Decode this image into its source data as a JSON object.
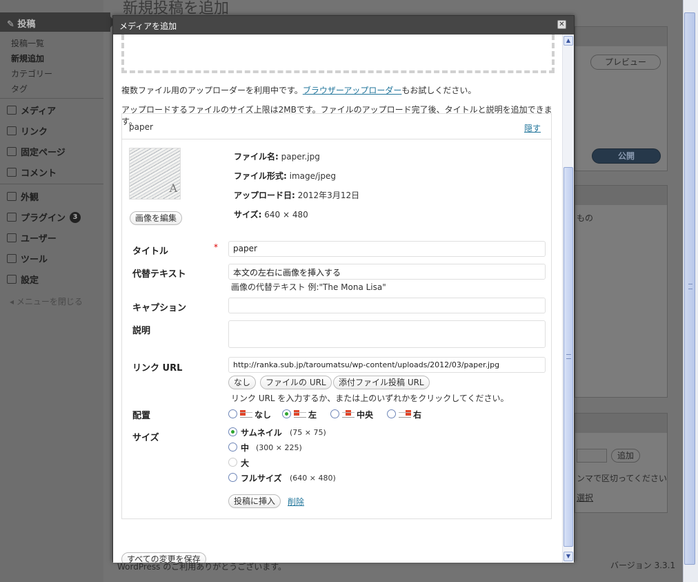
{
  "background": {
    "page_title": "新規投稿を追加",
    "menu_active": "投稿",
    "submenu": [
      "投稿一覧",
      "新規追加",
      "カテゴリー",
      "タグ"
    ],
    "menu": [
      {
        "label": "メディア",
        "icon": "media-icon"
      },
      {
        "label": "リンク",
        "icon": "link-icon"
      },
      {
        "label": "固定ページ",
        "icon": "page-icon"
      },
      {
        "label": "コメント",
        "icon": "comment-icon"
      },
      {
        "label": "外観",
        "icon": "appearance-icon"
      },
      {
        "label": "プラグイン",
        "icon": "plugin-icon",
        "badge": "3"
      },
      {
        "label": "ユーザー",
        "icon": "users-icon"
      },
      {
        "label": "ツール",
        "icon": "tools-icon"
      },
      {
        "label": "設定",
        "icon": "settings-icon"
      }
    ],
    "collapse_label": "メニューを閉じる",
    "preview_label": "プレビュー",
    "publish_label": "公開",
    "add_label": "追加",
    "side_text_1": "もの",
    "side_text_2": "ンマで区切ってください",
    "side_text_3": "選択",
    "footer_left": "WordPress のご利用ありがとうございます。",
    "version": "バージョン 3.3.1"
  },
  "modal": {
    "title": "メディアを追加",
    "close_glyph": "✕",
    "multi_uploader_note_pre": "複数ファイル用のアップローダーを利用中です。",
    "multi_uploader_link": "ブラウザーアップローダー",
    "multi_uploader_note_post": "もお試しください。",
    "size_limit_note": "アップロードするファイルのサイズ上限は2MBです。ファイルのアップロード完了後、タイトルと説明を追加できます。",
    "item": {
      "name": "paper",
      "hide_link": "隠す",
      "filename_label": "ファイル名:",
      "filename": "paper.jpg",
      "filetype_label": "ファイル形式:",
      "filetype": "image/jpeg",
      "upload_date_label": "アップロード日:",
      "upload_date": "2012年3月12日",
      "size_label": "サイズ:",
      "dimensions": "640 × 480",
      "edit_image_button": "画像を編集",
      "fields": {
        "title_label": "タイトル",
        "required_mark": "*",
        "title_value": "paper",
        "alt_label": "代替テキスト",
        "alt_value": "本文の左右に画像を挿入する",
        "alt_help": "画像の代替テキスト 例:\"The Mona Lisa\"",
        "caption_label": "キャプション",
        "caption_value": "",
        "description_label": "説明",
        "description_value": "",
        "link_label": "リンク URL",
        "link_value": "http://ranka.sub.jp/taroumatsu/wp-content/uploads/2012/03/paper.jpg",
        "link_buttons": [
          "なし",
          "ファイルの URL",
          "添付ファイル投稿 URL"
        ],
        "link_help": "リンク URL を入力するか、または上のいずれかをクリックしてください。",
        "align_label": "配置",
        "align_options": [
          {
            "label": "なし",
            "selected": false
          },
          {
            "label": "左",
            "selected": true
          },
          {
            "label": "中央",
            "selected": false
          },
          {
            "label": "右",
            "selected": false
          }
        ],
        "size_field_label": "サイズ",
        "size_options": [
          {
            "label": "サムネイル",
            "dims": "(75 × 75)",
            "selected": true,
            "disabled": false
          },
          {
            "label": "中",
            "dims": "(300 × 225)",
            "selected": false,
            "disabled": false
          },
          {
            "label": "大",
            "dims": "",
            "selected": false,
            "disabled": true
          },
          {
            "label": "フルサイズ",
            "dims": "(640 × 480)",
            "selected": false,
            "disabled": false
          }
        ],
        "insert_button": "投稿に挿入",
        "delete_link": "削除"
      }
    },
    "save_all_button": "すべての変更を保存"
  }
}
